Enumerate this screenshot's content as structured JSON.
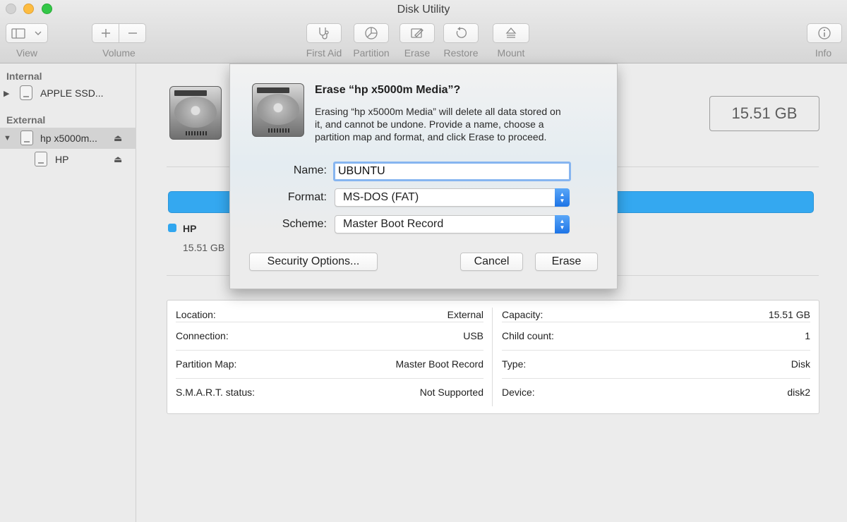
{
  "window": {
    "title": "Disk Utility"
  },
  "toolbar": {
    "view_label": "View",
    "volume_label": "Volume",
    "first_aid_label": "First Aid",
    "partition_label": "Partition",
    "erase_label": "Erase",
    "restore_label": "Restore",
    "mount_label": "Mount",
    "info_label": "Info"
  },
  "sidebar": {
    "internal_header": "Internal",
    "external_header": "External",
    "items": [
      {
        "label": "APPLE SSD..."
      },
      {
        "label": "hp x5000m..."
      },
      {
        "label": "HP"
      }
    ]
  },
  "main": {
    "capacity_display": "15.51 GB",
    "legend": {
      "name": "HP",
      "size": "15.51 GB",
      "color": "#34a8f0"
    },
    "info": {
      "left": [
        {
          "label": "Location:",
          "value": "External"
        },
        {
          "label": "Connection:",
          "value": "USB"
        },
        {
          "label": "Partition Map:",
          "value": "Master Boot Record"
        },
        {
          "label": "S.M.A.R.T. status:",
          "value": "Not Supported"
        }
      ],
      "right": [
        {
          "label": "Capacity:",
          "value": "15.51 GB"
        },
        {
          "label": "Child count:",
          "value": "1"
        },
        {
          "label": "Type:",
          "value": "Disk"
        },
        {
          "label": "Device:",
          "value": "disk2"
        }
      ]
    }
  },
  "dialog": {
    "title": "Erase “hp x5000m Media”?",
    "message_lines": [
      "Erasing “hp x5000m Media” will delete all data stored on",
      "it, and cannot be undone. Provide a name, choose a",
      "partition map and format, and click Erase to proceed."
    ],
    "name_label": "Name:",
    "name_value": "UBUNTU",
    "format_label": "Format:",
    "format_value": "MS-DOS (FAT)",
    "scheme_label": "Scheme:",
    "scheme_value": "Master Boot Record",
    "security_button": "Security Options...",
    "cancel_button": "Cancel",
    "erase_button": "Erase"
  }
}
